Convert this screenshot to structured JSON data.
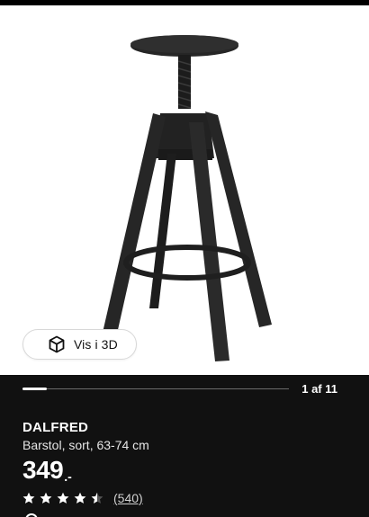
{
  "gallery": {
    "view_3d_label": "Vis i 3D",
    "view_3d_icon": "cube-icon",
    "counter": "1 af 11",
    "current_image": 1,
    "total_images": 11,
    "image_alt": "DALFRED"
  },
  "product": {
    "name": "DALFRED",
    "description": "Barstol, sort, 63-74 cm",
    "price": "349",
    "price_suffix": ".-",
    "rating": 4.5,
    "rating_max": 5,
    "review_count": "(540)"
  },
  "colors": {
    "background": "#111111",
    "text": "#ffffff",
    "image_background": "#ffffff",
    "product_color": "#262626"
  }
}
